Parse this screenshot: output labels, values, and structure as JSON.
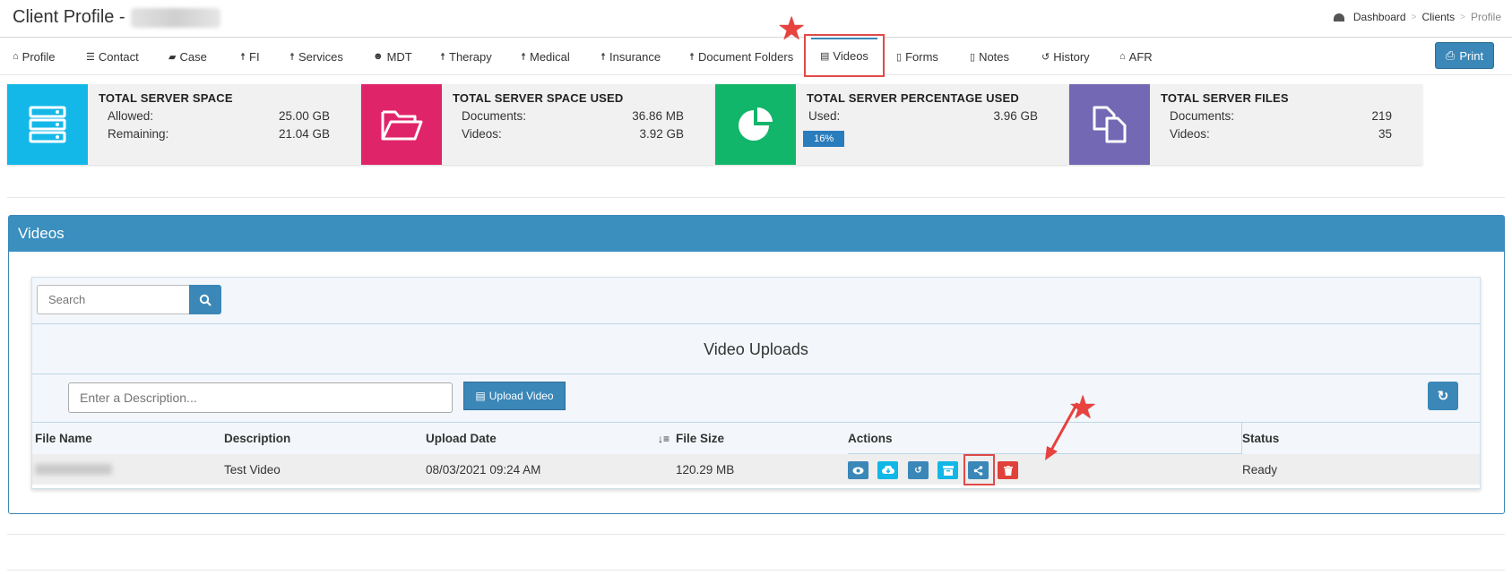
{
  "header": {
    "title": "Client Profile -",
    "breadcrumb": [
      "Dashboard",
      "Clients",
      "Profile"
    ],
    "breadcrumb_sep": ">"
  },
  "tabs": [
    {
      "label": "Profile",
      "icon": "home-icon"
    },
    {
      "label": "Contact",
      "icon": "list-icon"
    },
    {
      "label": "Case",
      "icon": "briefcase-icon"
    },
    {
      "label": "FI",
      "icon": "person-icon"
    },
    {
      "label": "Services",
      "icon": "person-icon"
    },
    {
      "label": "MDT",
      "icon": "group-icon"
    },
    {
      "label": "Therapy",
      "icon": "person-icon"
    },
    {
      "label": "Medical",
      "icon": "person-icon"
    },
    {
      "label": "Insurance",
      "icon": "person-icon"
    },
    {
      "label": "Document Folders",
      "icon": "person-icon"
    },
    {
      "label": "Videos",
      "icon": "video-file-icon",
      "active": true
    },
    {
      "label": "Forms",
      "icon": "document-icon"
    },
    {
      "label": "Notes",
      "icon": "document-icon"
    },
    {
      "label": "History",
      "icon": "history-icon"
    },
    {
      "label": "AFR",
      "icon": "home-icon"
    }
  ],
  "print_label": "Print",
  "stats": [
    {
      "title": "TOTAL SERVER SPACE",
      "color": "#14b8e8",
      "icon": "server-icon",
      "rows": [
        {
          "label": "Allowed:",
          "value": "25.00 GB"
        },
        {
          "label": "Remaining:",
          "value": "21.04 GB"
        }
      ]
    },
    {
      "title": "TOTAL SERVER SPACE USED",
      "color": "#e0246a",
      "icon": "folder-open-icon",
      "rows": [
        {
          "label": "Documents:",
          "value": "36.86 MB"
        },
        {
          "label": "Videos:",
          "value": "3.92 GB"
        }
      ]
    },
    {
      "title": "TOTAL SERVER PERCENTAGE USED",
      "color": "#12b66a",
      "icon": "pie-chart-icon",
      "rows": [
        {
          "label": "Used:",
          "value": "3.96 GB"
        }
      ],
      "progress_label": "16%",
      "progress": 0.16
    },
    {
      "title": "TOTAL SERVER FILES",
      "color": "#7368b3",
      "icon": "files-icon",
      "rows": [
        {
          "label": "Documents:",
          "value": "219"
        },
        {
          "label": "Videos:",
          "value": "35"
        }
      ]
    }
  ],
  "videos_panel": {
    "title": "Videos",
    "search_placeholder": "Search",
    "uploads_title": "Video Uploads",
    "description_placeholder": "Enter a Description...",
    "upload_label": "Upload Video",
    "columns": [
      "File Name",
      "Description",
      "Upload Date",
      "File Size",
      "Actions",
      "Status"
    ],
    "rows": [
      {
        "file_name": "",
        "description": "Test Video",
        "upload_date": "08/03/2021 09:24 AM",
        "file_size": "120.29 MB",
        "status": "Ready"
      }
    ],
    "actions": [
      {
        "name": "view",
        "icon": "eye-icon",
        "color": "#3a87b8"
      },
      {
        "name": "download",
        "icon": "cloud-download-icon",
        "color": "#11b7e6"
      },
      {
        "name": "restore",
        "icon": "history-icon",
        "color": "#3a87b8"
      },
      {
        "name": "archive",
        "icon": "archive-icon",
        "color": "#11b7e6"
      },
      {
        "name": "share",
        "icon": "share-icon",
        "color": "#3a87b8"
      },
      {
        "name": "delete",
        "icon": "trash-icon",
        "color": "#e0413a"
      }
    ]
  }
}
